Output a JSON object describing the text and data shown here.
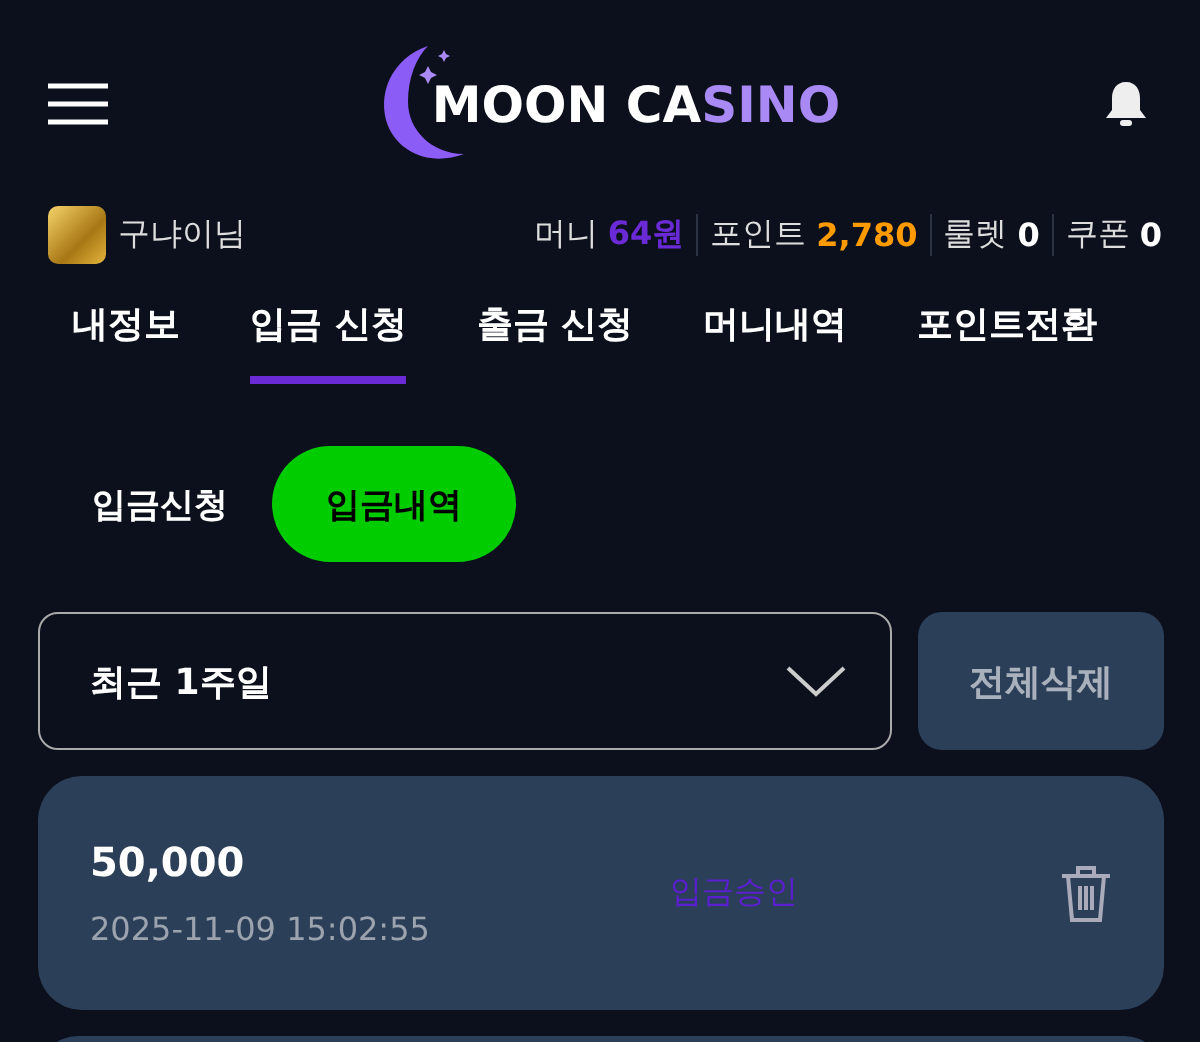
{
  "header": {
    "logo_part_1": "MOON CA",
    "logo_part_2": "SINO"
  },
  "user": {
    "name": "구냐이님",
    "stats": [
      {
        "label": "머니",
        "value": "64원",
        "color": "#6a2bd6"
      },
      {
        "label": "포인트",
        "value": "2,780",
        "color": "#ff9a00"
      },
      {
        "label": "룰렛",
        "value": "0",
        "color": "#ffffff"
      },
      {
        "label": "쿠폰",
        "value": "0",
        "color": "#ffffff"
      }
    ]
  },
  "tabs": [
    {
      "label": "내정보",
      "selected": false
    },
    {
      "label": "입금 신청",
      "selected": true
    },
    {
      "label": "출금 신청",
      "selected": false
    },
    {
      "label": "머니내역",
      "selected": false
    },
    {
      "label": "포인트전환",
      "selected": false
    }
  ],
  "sub_tabs": [
    {
      "label": "입금신청",
      "selected": false
    },
    {
      "label": "입금내역",
      "selected": true
    }
  ],
  "filter": {
    "value": "최근 1주일"
  },
  "delete_all_button": "전체삭제",
  "records": [
    {
      "amount": "50,000",
      "date": "2025-11-09 15:02:55",
      "status": "입금승인"
    }
  ]
}
